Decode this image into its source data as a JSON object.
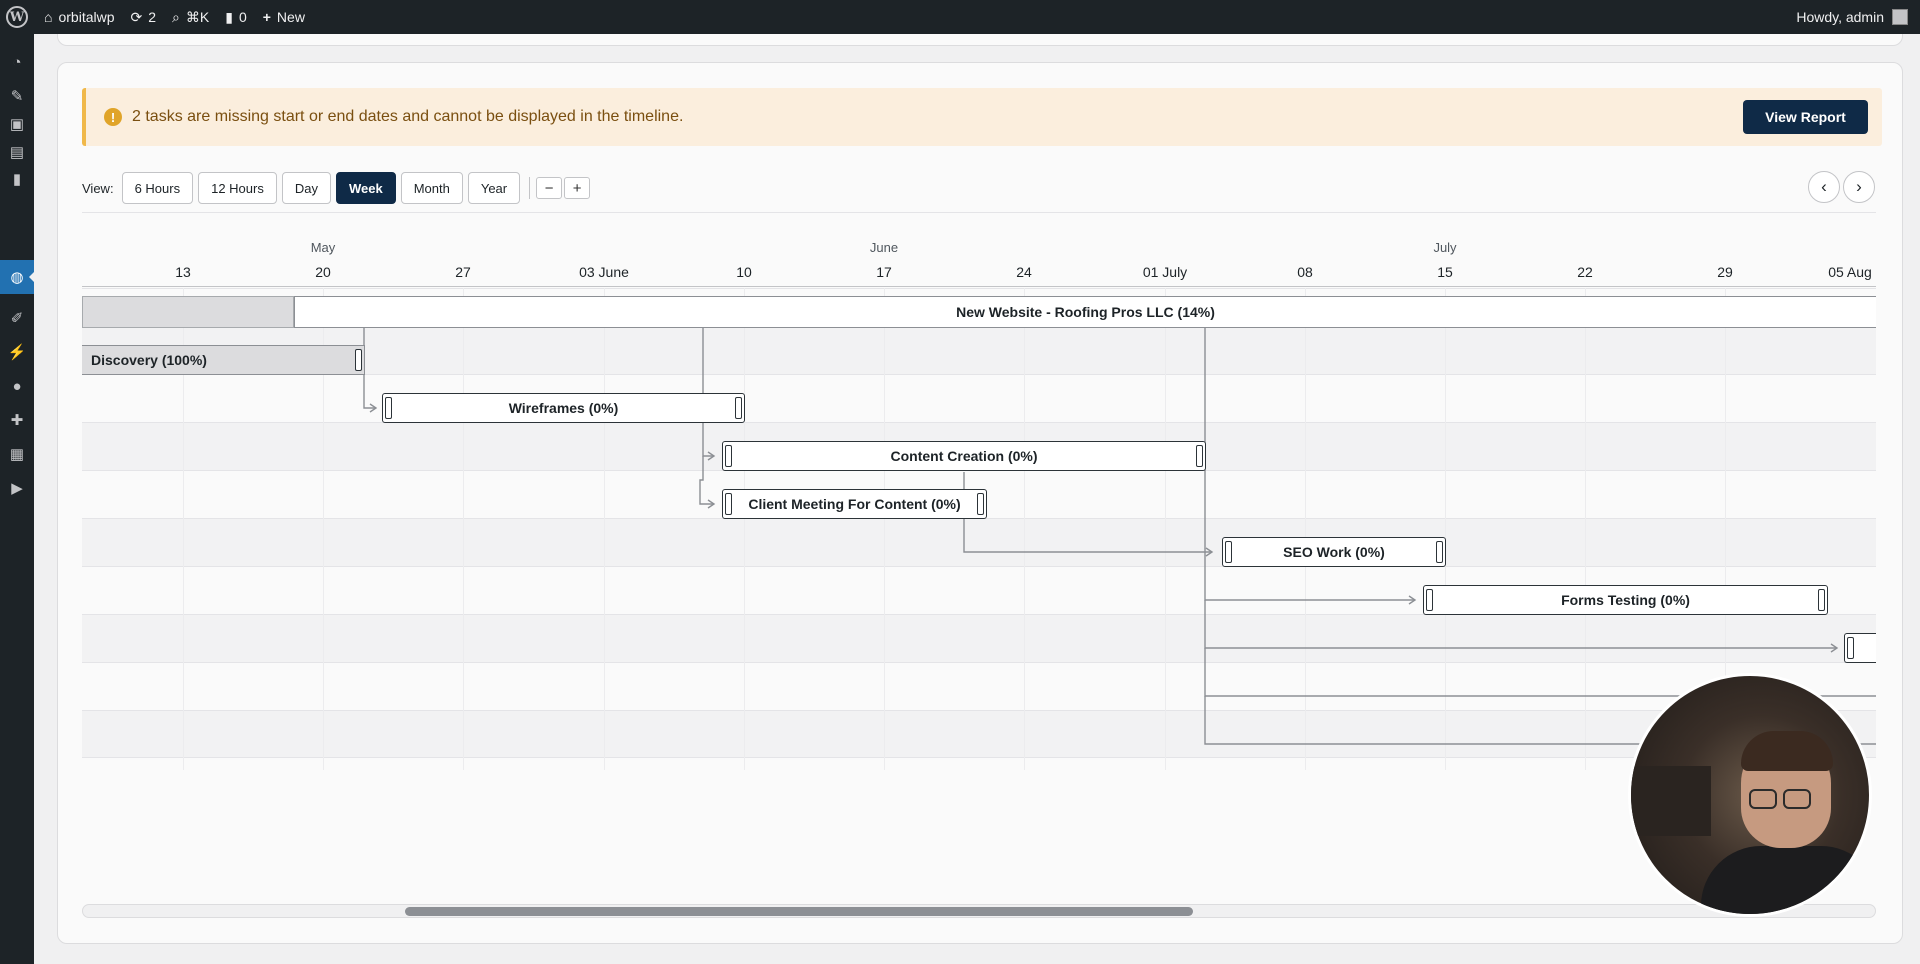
{
  "adminbar": {
    "site_name": "orbitalwp",
    "updates_count": "2",
    "shortcut": "⌘K",
    "comments_count": "0",
    "new_label": "New",
    "greeting": "Howdy, admin"
  },
  "notice": {
    "message": "2 tasks are missing start or end dates and cannot be displayed in the timeline.",
    "button": "View Report"
  },
  "view": {
    "label": "View:",
    "options": [
      "6 Hours",
      "12 Hours",
      "Day",
      "Week",
      "Month",
      "Year"
    ],
    "selected": "Week",
    "zoom_out": "−",
    "zoom_in": "+"
  },
  "timeline": {
    "months": [
      "May",
      "June",
      "July"
    ],
    "ticks": [
      "13",
      "20",
      "27",
      "03 June",
      "10",
      "17",
      "24",
      "01 July",
      "08",
      "15",
      "22",
      "29",
      "05 Aug"
    ]
  },
  "project": {
    "label": "New Website - Roofing Pros LLC (14%)",
    "progress": 0.14
  },
  "tasks": [
    {
      "label": "Discovery (100%)",
      "progress": 1.0
    },
    {
      "label": "Wireframes (0%)",
      "progress": 0
    },
    {
      "label": "Content Creation (0%)",
      "progress": 0
    },
    {
      "label": "Client Meeting For Content (0%)",
      "progress": 0
    },
    {
      "label": "SEO Work (0%)",
      "progress": 0
    },
    {
      "label": "Forms Testing (0%)",
      "progress": 0
    },
    {
      "label": "",
      "progress": 0
    }
  ],
  "scrollbar": {
    "position": 0.18,
    "visible_fraction": 0.44
  },
  "icons": {
    "sidebar": [
      "dashboard-icon",
      "pin-icon",
      "media-icon",
      "pages-icon",
      "comments-icon",
      "globe-icon",
      "appearance-icon",
      "plugins-icon",
      "users-icon",
      "tools-icon",
      "settings-icon",
      "play-icon"
    ]
  }
}
